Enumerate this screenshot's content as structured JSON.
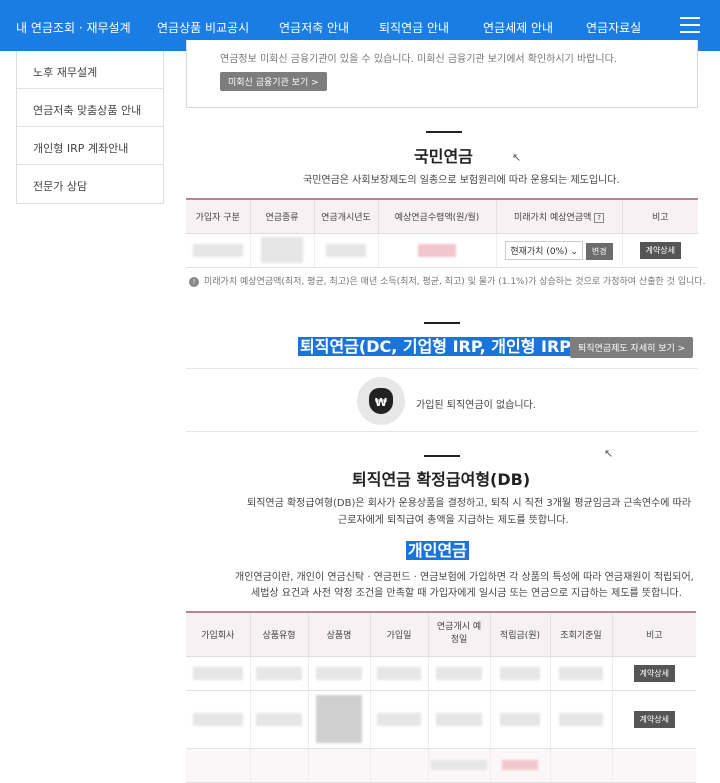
{
  "nav": {
    "items": [
      "내 연금조회 · 재무설계",
      "연금상품 비교공시",
      "연금저축 안내",
      "퇴직연금 안내",
      "연금세제 안내",
      "연금자료실"
    ],
    "menu_icon": "hamburger-menu-icon"
  },
  "sidebar": {
    "items": [
      "노후 재무설계",
      "연금저축 맞춤상품 안내",
      "개인형 IRP 계좌안내",
      "전문가 상담"
    ]
  },
  "notice": {
    "text": "연금정보 미회신 금융기관이 있을 수 있습니다. 미회신 금융기관 보기에서 확인하시기 바랍니다.",
    "button": "미회신 금융기관 보기 >"
  },
  "national": {
    "title": "국민연금",
    "desc": "국민연금은 사회보장제도의 일종으로 보험원리에 따라 운용되는 제도입니다.",
    "headers": [
      "가입자 구분",
      "연금종류",
      "연금개시년도",
      "예상연금수령액(원/월)",
      "미래가치 예상연금액",
      "비고"
    ],
    "help_icon": "?",
    "select_value": "현재가치 (0%)",
    "change_button": "변경",
    "detail_button": "계약상세",
    "footnote": "미래가치 예상연금액(최저, 평균, 최고)은 매년 소득(최저, 평균, 최고) 및 물가 (1.1%)가 상승하는 것으로 가정하여 산출한 것 입니다."
  },
  "retirement": {
    "title": "퇴직연금(DC, 기업형 IRP, 개인형 IRP)",
    "detail_button": "퇴직연금제도 자세히 보기 >",
    "coin_symbol": "₩",
    "empty_text": "가입된 퇴직연금이 없습니다."
  },
  "db": {
    "title": "퇴직연금 확정급여형(DB)",
    "desc_line1": "퇴직연금 확정급여형(DB)은 회사가 운용상품을 결정하고, 퇴직 시 직전 3개월 평균임금과 근속연수에 따라",
    "desc_line2": "근로자에게 퇴직급여 총액을 지급하는 제도를 뜻합니다."
  },
  "personal": {
    "title": "개인연금",
    "desc_line1": "개인연금이란, 개인이 연금신탁 · 연금펀드 · 연금보험에 가입하면 각 상품의 특성에 따라 연금재원이 적립되어,",
    "desc_line2": "세법상 요건과 사전 약정 조건을 만족할 때 가입자에게 일시금 또는 연금으로 지급하는 제도를 뜻합니다.",
    "headers": [
      "가입회사",
      "상품유형",
      "상품명",
      "가입일",
      "연금개시 예정일",
      "적립금(원)",
      "조회기준일",
      "비고"
    ],
    "detail_button": "계약상세"
  }
}
